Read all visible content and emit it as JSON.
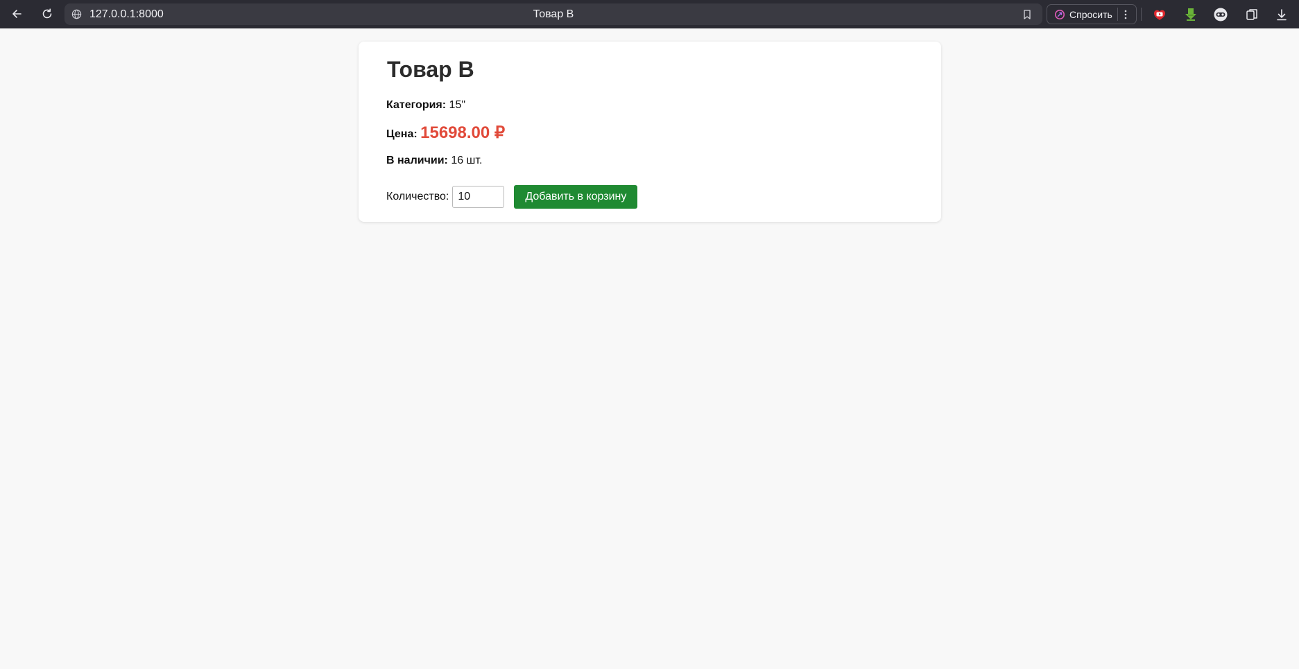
{
  "browser": {
    "url": "127.0.0.1:8000",
    "tab_title": "Товар В",
    "ask_label": "Спросить",
    "icons": {
      "back": "back-arrow-icon",
      "reload": "reload-icon",
      "site": "globe-icon",
      "bookmark": "bookmark-icon",
      "ask": "ai-assistant-icon",
      "more": "more-vertical-icon",
      "extensions": [
        "youtube-extension-icon",
        "download-arrow-extension-icon",
        "mask-extension-icon",
        "collections-icon",
        "downloads-icon"
      ]
    }
  },
  "product": {
    "title": "Товар В",
    "category_label": "Категория:",
    "category_value": "15\"",
    "price_label": "Цена:",
    "price_value": "15698.00 ₽",
    "stock_label": "В наличии:",
    "stock_value": "16 шт.",
    "quantity_label": "Количество:",
    "quantity_value": "10",
    "add_to_cart_label": "Добавить в корзину"
  },
  "colors": {
    "chrome_bg": "#2b2b33",
    "page_bg": "#f8f8f8",
    "price": "#e14a3a",
    "button": "#1f8a32"
  }
}
